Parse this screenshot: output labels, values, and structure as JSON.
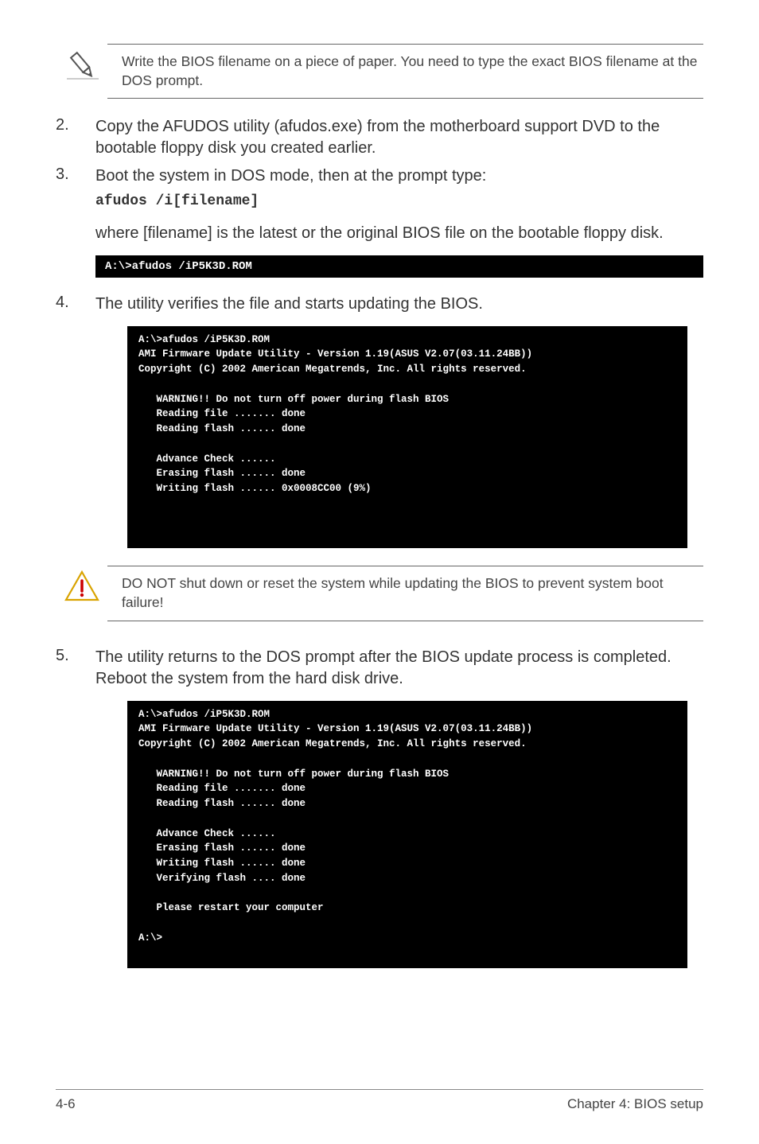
{
  "note": {
    "text": "Write the BIOS filename on a piece of paper. You need to type the exact BIOS filename at the DOS prompt."
  },
  "steps": {
    "s2": {
      "num": "2.",
      "text": "Copy the AFUDOS utility (afudos.exe) from the motherboard support DVD to the bootable floppy disk you created earlier."
    },
    "s3": {
      "num": "3.",
      "text": "Boot the system in DOS mode, then at the prompt type:",
      "cmd": "afudos /i[filename]",
      "sub": "where [filename] is the latest or the original BIOS file on the bootable floppy disk."
    },
    "s4": {
      "num": "4.",
      "text": "The utility verifies the file and starts updating the BIOS."
    },
    "s5": {
      "num": "5.",
      "text": "The utility returns to the DOS prompt after the BIOS update process is completed. Reboot the system from the hard disk drive."
    }
  },
  "terminals": {
    "t1": "A:\\>afudos /iP5K3D.ROM",
    "t2": "A:\\>afudos /iP5K3D.ROM\nAMI Firmware Update Utility - Version 1.19(ASUS V2.07(03.11.24BB))\nCopyright (C) 2002 American Megatrends, Inc. All rights reserved.\n\n   WARNING!! Do not turn off power during flash BIOS\n   Reading file ....... done\n   Reading flash ...... done\n\n   Advance Check ......\n   Erasing flash ...... done\n   Writing flash ...... 0x0008CC00 (9%)\n\n\n",
    "t3": "A:\\>afudos /iP5K3D.ROM\nAMI Firmware Update Utility - Version 1.19(ASUS V2.07(03.11.24BB))\nCopyright (C) 2002 American Megatrends, Inc. All rights reserved.\n\n   WARNING!! Do not turn off power during flash BIOS\n   Reading file ....... done\n   Reading flash ...... done\n\n   Advance Check ......\n   Erasing flash ...... done\n   Writing flash ...... done\n   Verifying flash .... done\n\n   Please restart your computer\n\nA:\\>"
  },
  "caution": {
    "text": "DO NOT shut down or reset the system while updating the BIOS to prevent system boot failure!"
  },
  "footer": {
    "left": "4-6",
    "right": "Chapter 4: BIOS setup"
  }
}
